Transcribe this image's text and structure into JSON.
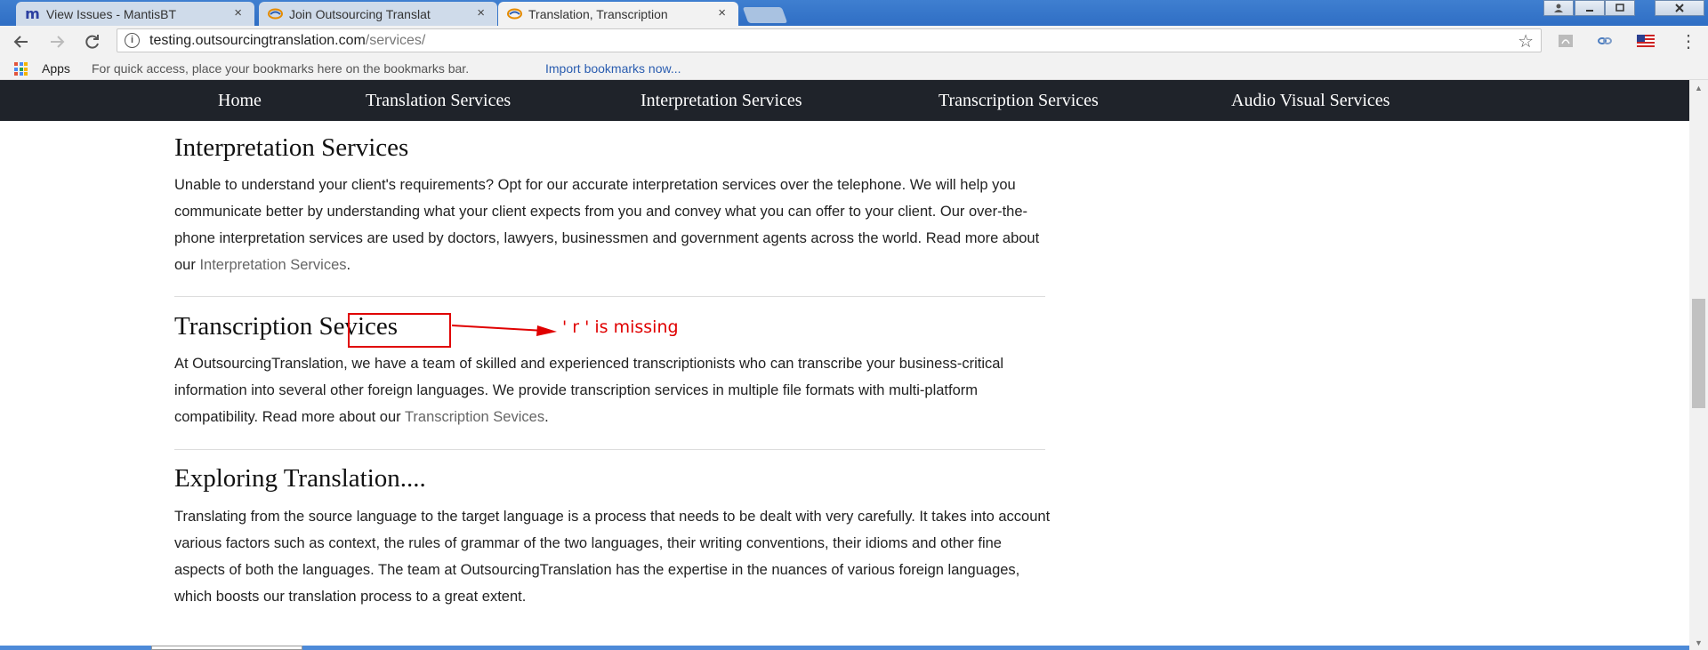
{
  "browser": {
    "tabs": [
      {
        "title": "View Issues - MantisBT",
        "favicon": "mantis-icon",
        "active": false
      },
      {
        "title": "Join Outsourcing Translat",
        "favicon": "ot-logo-icon",
        "active": false
      },
      {
        "title": "Translation, Transcription",
        "favicon": "ot-logo-icon",
        "active": true
      }
    ],
    "close_glyph": "×",
    "url_host": "testing.outsourcingtranslation.com",
    "url_path": "/services/",
    "bookmarks": {
      "apps_label": "Apps",
      "hint": "For quick access, place your bookmarks here on the bookmarks bar.",
      "import_link": "Import bookmarks now..."
    }
  },
  "site_nav": {
    "items": [
      "Home",
      "Translation Services",
      "Interpretation Services",
      "Transcription Services",
      "Audio Visual Services"
    ]
  },
  "sections": [
    {
      "title": "Interpretation Services",
      "body": "Unable to understand your client's requirements? Opt for our accurate interpretation services over the telephone. We will help you communicate better by understanding what your client expects from you and convey what you can offer to your client. Our over-the-phone interpretation services are used by doctors, lawyers, businessmen and government agents across the world. Read more about our ",
      "link": "Interpretation Services",
      "tail": "."
    },
    {
      "title_prefix": "Transcription ",
      "title_highlight": "Sevices",
      "body": "At OutsourcingTranslation, we have a team of skilled and experienced transcriptionists who can transcribe your business-critical information into several other foreign languages. We provide transcription services in multiple file formats with multi-platform compatibility. Read more about our ",
      "link": "Transcription Sevices",
      "tail": "."
    },
    {
      "title": "Exploring Translation....",
      "body": "Translating from the source language to the target language is a process that needs to be dealt with very carefully. It takes into account various factors such as context, the rules of grammar of the two languages, their writing conventions, their idioms and other fine aspects of both the languages. The team at OutsourcingTranslation has the expertise in the nuances of various foreign languages, which boosts our translation process to a great extent."
    }
  ],
  "annotation": {
    "text": "' r ' is missing",
    "color": "#e00000"
  },
  "colors": {
    "nav_bg": "#1f232a",
    "tabstrip": "#3f7fd0",
    "link_gray": "#666666"
  }
}
